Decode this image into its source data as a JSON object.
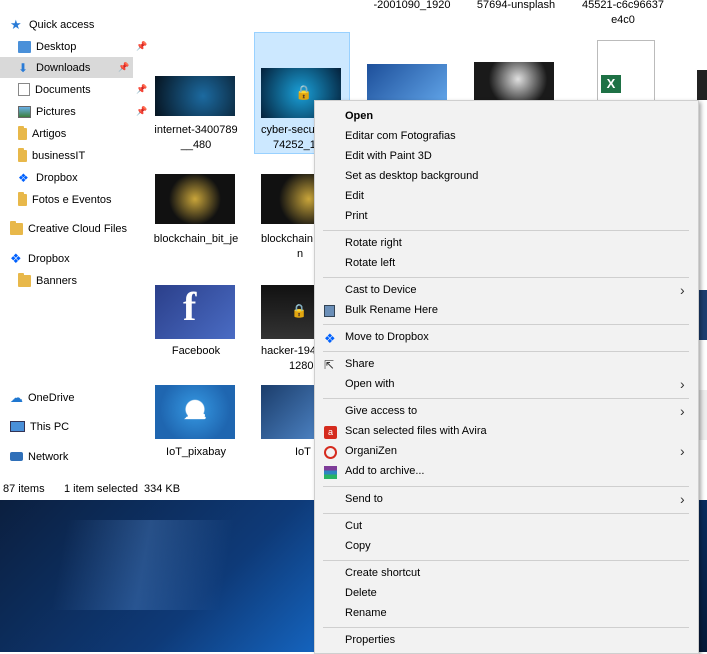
{
  "nav": {
    "quick_access": "Quick access",
    "items": [
      "Desktop",
      "Downloads",
      "Documents",
      "Pictures",
      "Artigos",
      "businessIT",
      "Dropbox",
      "Fotos e Eventos"
    ],
    "creative_cloud": "Creative Cloud Files",
    "dropbox": "Dropbox",
    "banners": "Banners",
    "onedrive": "OneDrive",
    "this_pc": "This PC",
    "network": "Network"
  },
  "files": {
    "top_captions": [
      "-2001090_1920",
      "57694-unsplash",
      "45521-c6c96637",
      "e4c0"
    ],
    "row1": [
      [
        "internet-3400789",
        "__480"
      ],
      [
        "cyber-secu",
        "74252_1"
      ]
    ],
    "row2": [
      [
        "blockchain_bit_je",
        ""
      ],
      [
        "blockchain",
        "n"
      ]
    ],
    "row3": [
      [
        "Facebook",
        ""
      ],
      [
        "hacker-194",
        "1280"
      ]
    ],
    "row4": [
      [
        "IoT_pixabay",
        ""
      ],
      [
        "IoT",
        ""
      ]
    ]
  },
  "status": {
    "items": "87 items",
    "selected": "1 item selected",
    "size": "334 KB"
  },
  "menu": {
    "open": "Open",
    "editar": "Editar com Fotografias",
    "paint3d": "Edit with Paint 3D",
    "desktop_bg": "Set as desktop background",
    "edit": "Edit",
    "print": "Print",
    "rotate_right": "Rotate right",
    "rotate_left": "Rotate left",
    "cast": "Cast to Device",
    "bulk_rename": "Bulk Rename Here",
    "move_dropbox": "Move to Dropbox",
    "share": "Share",
    "open_with": "Open with",
    "give_access": "Give access to",
    "avira": "Scan selected files with Avira",
    "organizen": "OrganiZen",
    "archive": "Add to archive...",
    "send_to": "Send to",
    "cut": "Cut",
    "copy": "Copy",
    "shortcut": "Create shortcut",
    "delete": "Delete",
    "rename": "Rename",
    "properties": "Properties"
  },
  "colors": {
    "folder": "#e8b84a",
    "selection": "#cce8ff",
    "menu_bg": "#f2f2f2",
    "dropbox": "#0061fe",
    "avira": "#d52b1e"
  }
}
